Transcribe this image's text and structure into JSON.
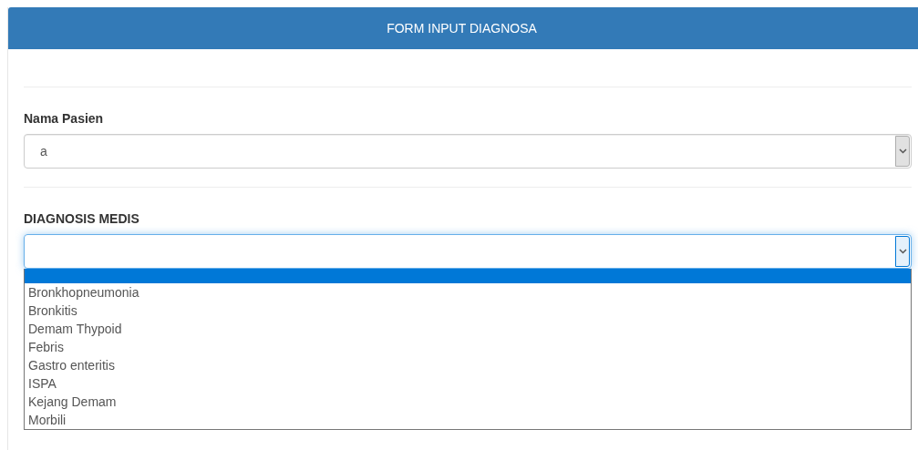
{
  "panel": {
    "title": "FORM INPUT DIAGNOSA"
  },
  "fields": [
    {
      "label": "Nama Pasien",
      "value": "a",
      "focused": false
    },
    {
      "label": "DIAGNOSIS MEDIS",
      "focused": true,
      "options": [
        {
          "selected": true
        },
        {
          "label": "Bronkhopneumonia",
          "selected": false
        },
        {
          "label": "Bronkitis",
          "selected": false
        },
        {
          "label": "Demam Thypoid",
          "selected": false
        },
        {
          "label": "Febris",
          "selected": false
        },
        {
          "label": "Gastro enteritis",
          "selected": false
        },
        {
          "label": "ISPA",
          "selected": false
        },
        {
          "label": "Kejang Demam",
          "selected": false
        },
        {
          "label": "Morbili",
          "selected": false
        }
      ]
    }
  ]
}
